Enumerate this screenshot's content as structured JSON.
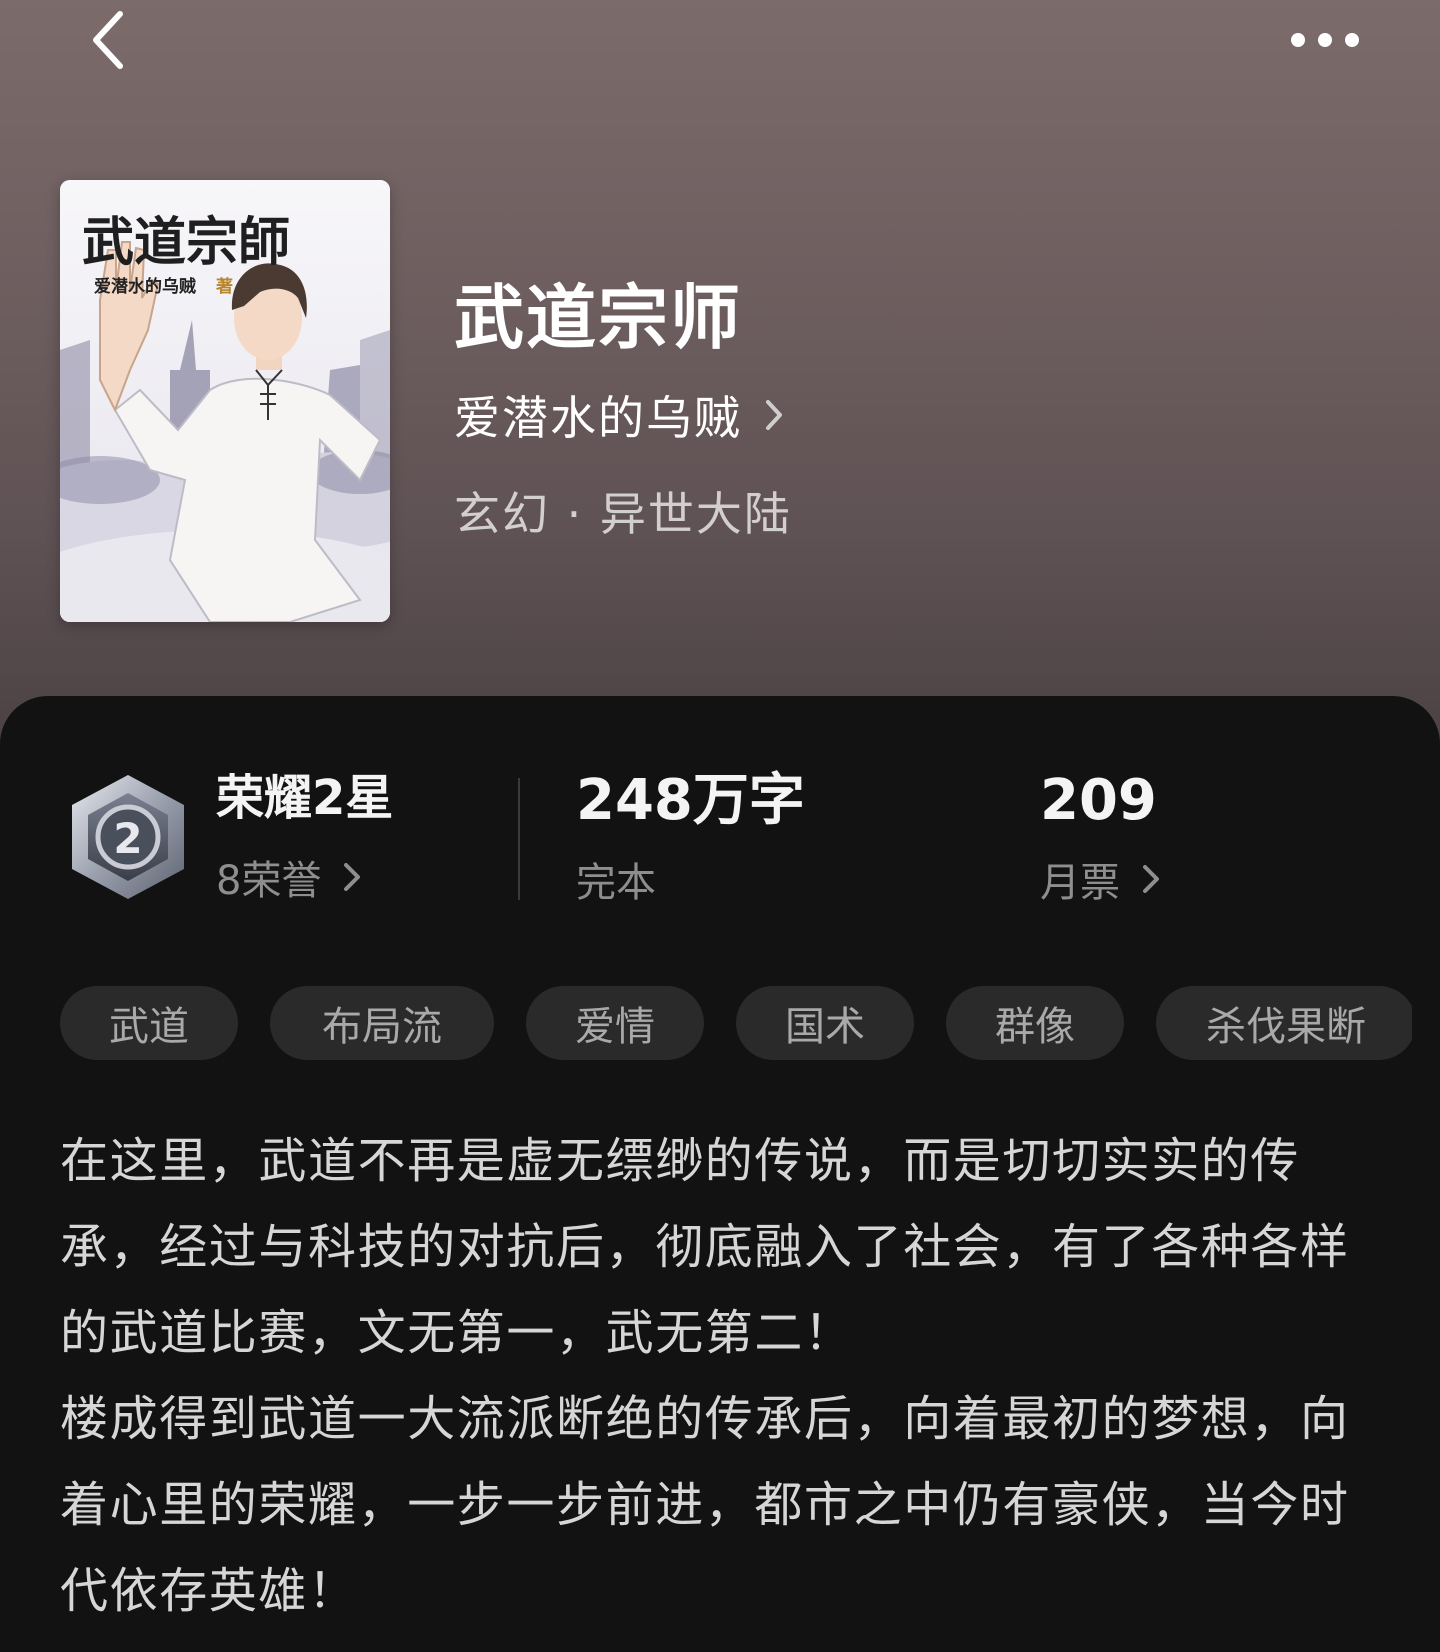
{
  "nav": {
    "back_icon": "chevron-left-icon",
    "more_icon": "more-dots-icon"
  },
  "book": {
    "title": "武道宗师",
    "author": "爱潜水的乌贼",
    "genre": "玄幻 · 异世大陆",
    "cover": {
      "title_calligraphy": "武道宗師",
      "author_line": "爱潜水的乌贼",
      "author_suffix": "著"
    }
  },
  "stats": {
    "honor": {
      "title": "荣耀2星",
      "count_label": "8荣誉",
      "badge_number": "2"
    },
    "words": {
      "value": "248万字",
      "status": "完本"
    },
    "tickets": {
      "value": "209",
      "label": "月票"
    }
  },
  "tags": [
    "武道",
    "布局流",
    "爱情",
    "国术",
    "群像",
    "杀伐果断"
  ],
  "description": [
    "在这里，武道不再是虚无缥缈的传说，而是切切实实的传承，经过与科技的对抗后，彻底融入了社会，有了各种各样的武道比赛，文无第一，武无第二！",
    "楼成得到武道一大流派断绝的传承后，向着最初的梦想，向着心里的荣耀，一步一步前进，都市之中仍有豪侠，当今时代依存英雄！"
  ],
  "colors": {
    "panel": "#121212",
    "hero": "#6f5f60",
    "tag_bg": "#2a2a2a"
  }
}
